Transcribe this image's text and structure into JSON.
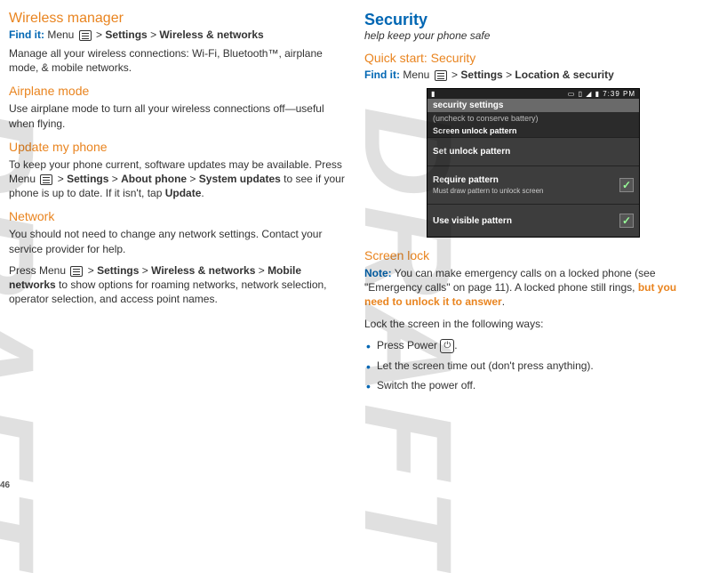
{
  "page_number": "46",
  "left": {
    "h_section": "Wireless manager",
    "findit_label": "Find it:",
    "findit_prefix": "Menu",
    "findit_path_1": "Settings",
    "findit_path_2": "Wireless & networks",
    "intro": "Manage all your wireless connections: Wi-Fi, Bluetooth™, airplane mode, & mobile networks.",
    "airplane_h": "Airplane mode",
    "airplane_body": "Use airplane mode to turn all your wireless connections off—useful when flying.",
    "update_h": "Update my phone",
    "update_body_1": "To keep your phone current, software updates may be available. Press Menu",
    "update_path_1": "Settings",
    "update_path_2": "About phone",
    "update_path_3": "System updates",
    "update_body_2": " to see if your phone is up to date. If it isn't, tap ",
    "update_tap": "Update",
    "network_h": "Network",
    "network_body_1": "You should not need to change any network settings. Contact your service provider for help.",
    "network_body_2a": "Press Menu",
    "network_path_1": "Settings",
    "network_path_2": "Wireless & networks",
    "network_path_3": "Mobile networks",
    "network_body_2b": " to show options for roaming networks, network selection, operator selection, and access point names."
  },
  "right": {
    "h_major": "Security",
    "tagline": "help keep your phone safe",
    "quick_h": "Quick start: Security",
    "findit_label": "Find it:",
    "findit_prefix": "Menu",
    "findit_path_1": "Settings",
    "findit_path_2": "Location & security",
    "phone": {
      "status_left": "▮",
      "status_right_icons": "▭ ▯ ◢ ▮",
      "status_time": "7:39 PM",
      "title": "security settings",
      "sub1": "(uncheck to conserve battery)",
      "sub2": "Screen unlock pattern",
      "row1": "Set unlock pattern",
      "row2": "Require pattern",
      "row2_sub": "Must draw pattern to unlock screen",
      "row3": "Use visible pattern",
      "check": "✓"
    },
    "screenlock_h": "Screen lock",
    "note_label": "Note:",
    "note_body_1": " You can make emergency calls on a locked phone (see \"Emergency calls\" on page 11). A locked phone still rings, ",
    "note_link": "but you need to unlock it to answer",
    "lock_ways": "Lock the screen in the following ways:",
    "bullets": {
      "b1_a": "Press Power ",
      "b1_b": ".",
      "power_glyph": "⏻",
      "b2": "Let the screen time out (don't press anything).",
      "b3": "Switch the power off."
    }
  }
}
